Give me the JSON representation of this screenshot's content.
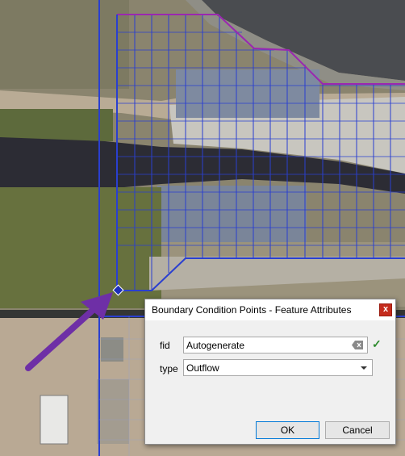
{
  "dialog": {
    "title": "Boundary Condition Points - Feature Attributes",
    "close_symbol": "x",
    "fields": [
      {
        "label": "fid",
        "value": "Autogenerate"
      },
      {
        "label": "type",
        "value": "Outflow"
      }
    ],
    "ok_label": "OK",
    "cancel_label": "Cancel"
  },
  "icons": {
    "clear": "clear-text-icon",
    "valid": "valid-check-icon",
    "dropdown": "chevron-down-icon"
  },
  "colors": {
    "grid_line": "#2a3fd0",
    "boundary_line": "#9b27b0",
    "arrow": "#6e2fa6",
    "close_button": "#c42b1c",
    "check": "#2e8b2e"
  }
}
